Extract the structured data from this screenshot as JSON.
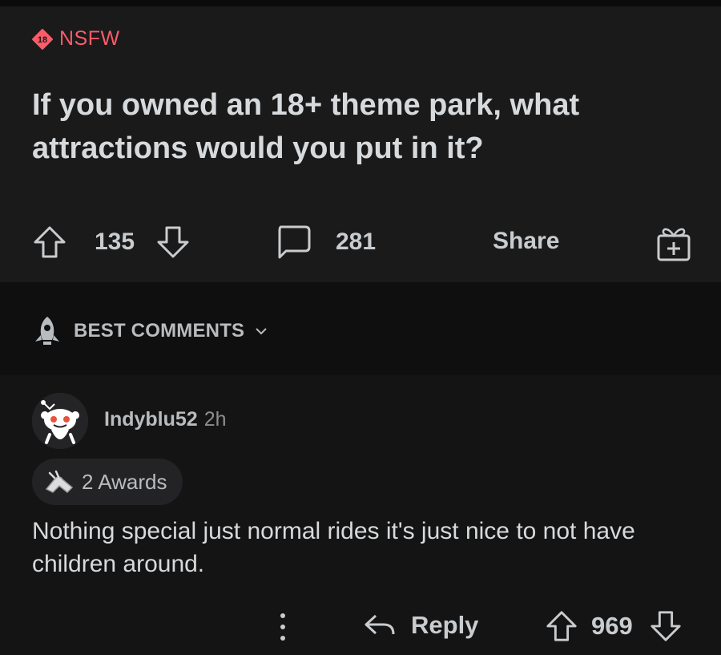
{
  "post": {
    "badge": "18",
    "nsfw_label": "NSFW",
    "title": "If you owned an 18+ theme park, what attractions would you put in it?",
    "upvotes": "135",
    "comments": "281",
    "share_label": "Share"
  },
  "sort": {
    "label": "BEST COMMENTS"
  },
  "comment": {
    "author": "Indyblu52",
    "time": "2h",
    "awards": "2 Awards",
    "body": "Nothing special just normal rides it's just nice to not have children around.",
    "reply_label": "Reply",
    "score": "969"
  },
  "colors": {
    "nsfw": "#ff5a68",
    "post_bg": "#1a1a1b",
    "page_bg": "#111112"
  },
  "icons": [
    "nsfw-18-badge",
    "upvote-icon",
    "downvote-icon",
    "comment-icon",
    "gift-icon",
    "rocket-icon",
    "chevron-down-icon",
    "snoo-avatar",
    "award-icon",
    "more-icon",
    "reply-icon"
  ]
}
